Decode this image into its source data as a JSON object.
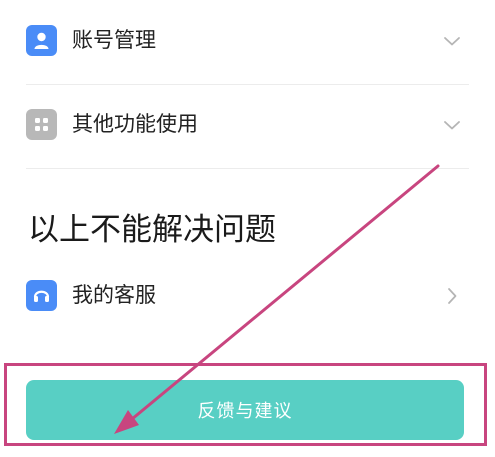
{
  "menu": {
    "items": [
      {
        "label": "账号管理",
        "icon": "person-icon",
        "color": "#4a8cf7",
        "chevron": "chevron-down"
      },
      {
        "label": "其他功能使用",
        "icon": "grid-icon",
        "color": "#b8b8b8",
        "chevron": "chevron-down"
      }
    ]
  },
  "section": {
    "title": "以上不能解决问题"
  },
  "service": {
    "label": "我的客服",
    "icon": "headset-icon",
    "color": "#4a8cf7",
    "chevron": "chevron-right"
  },
  "feedback": {
    "label": "反馈与建议",
    "color": "#58cfc4"
  },
  "annotation": {
    "color": "#c8457f"
  }
}
